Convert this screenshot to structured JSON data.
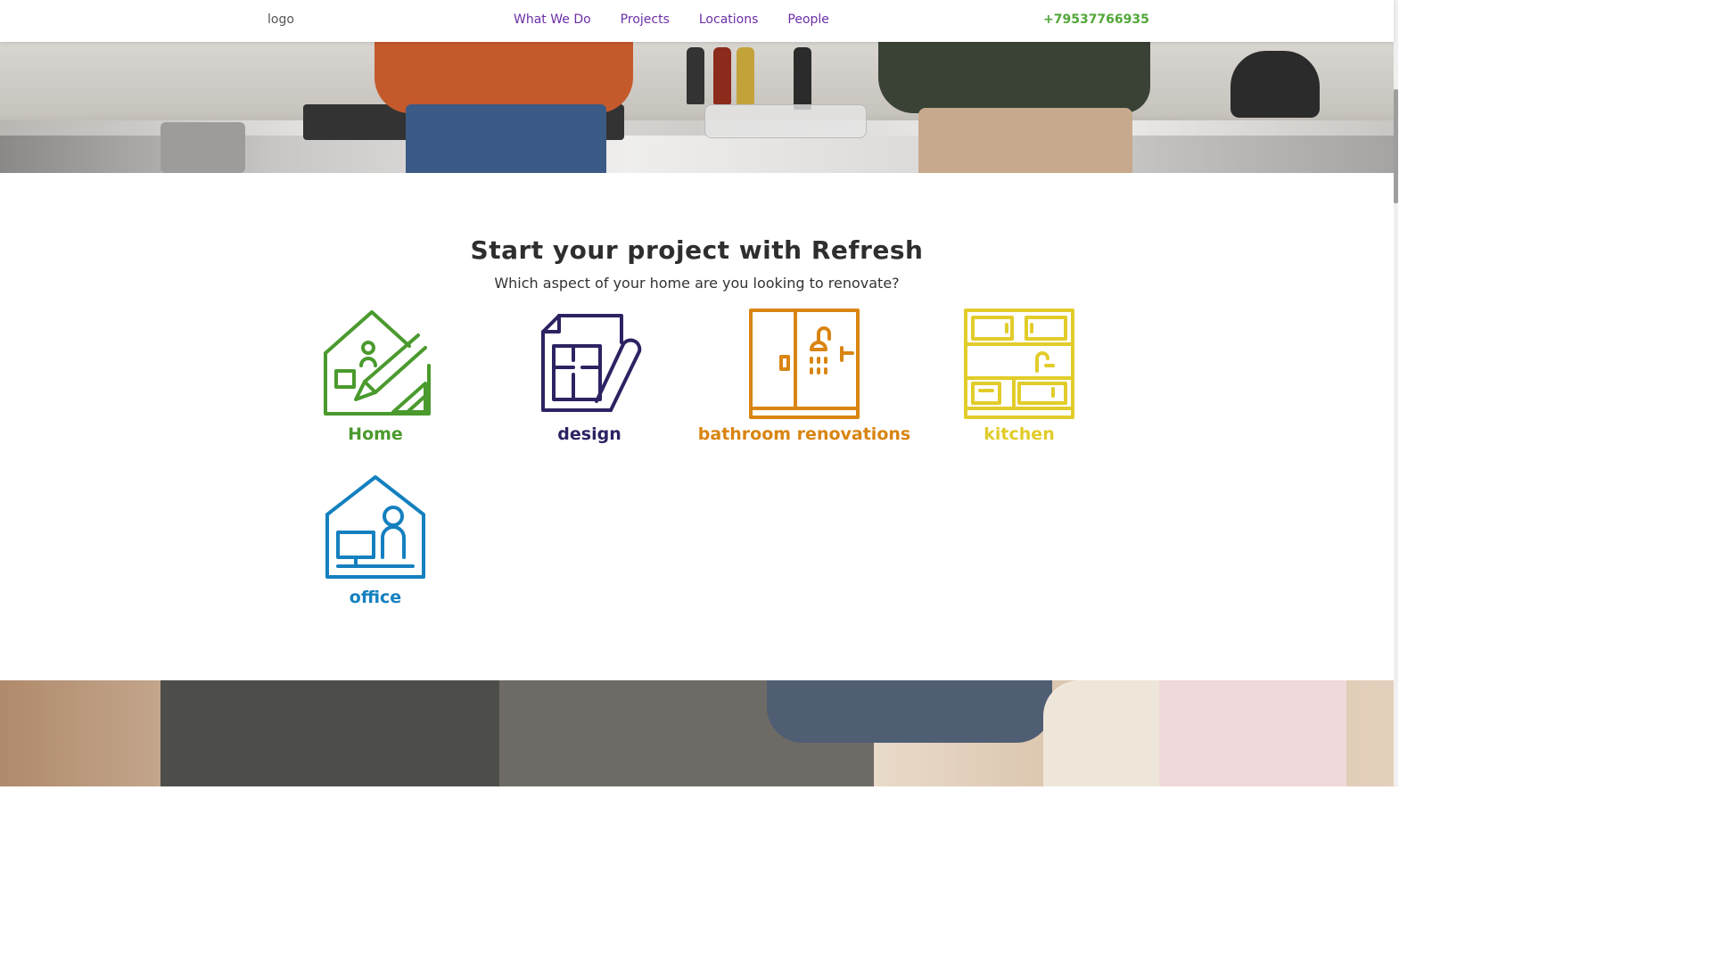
{
  "header": {
    "logo": "logo",
    "nav": [
      "What We Do",
      "Projects",
      "Locations",
      "People"
    ],
    "phone": "+79537766935"
  },
  "main": {
    "title": "Start your project with Refresh",
    "subtitle": "Which aspect of your home are you looking to renovate?",
    "categories": [
      {
        "label": "Home",
        "color": "#4a9a2d",
        "icon": "house-pencil-icon"
      },
      {
        "label": "design",
        "color": "#2b2362",
        "icon": "blueprint-icon"
      },
      {
        "label": "bathroom renovations",
        "color": "#d98512",
        "icon": "shower-cabin-icon"
      },
      {
        "label": "kitchen",
        "color": "#e2cc2a",
        "icon": "kitchen-cabinet-icon"
      },
      {
        "label": "office",
        "color": "#1480bf",
        "icon": "home-office-icon"
      }
    ]
  },
  "colors": {
    "nav": "#6b2fa6",
    "phone": "#52a73a",
    "title": "#2e2e2e"
  }
}
